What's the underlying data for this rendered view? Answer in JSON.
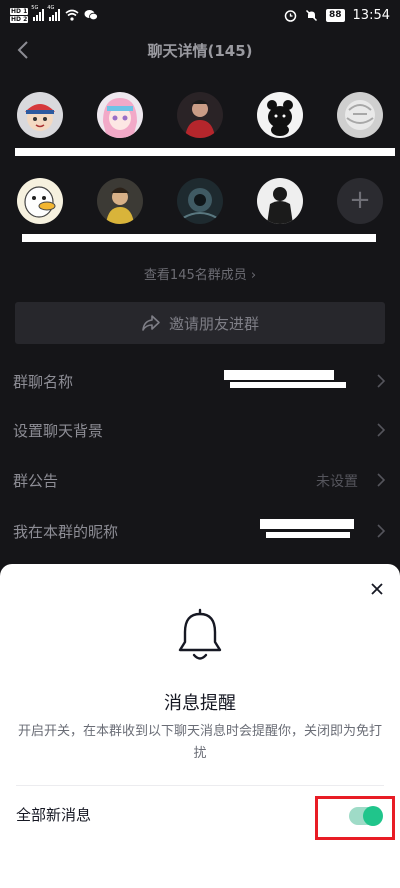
{
  "status_bar": {
    "sim1": "HD 1",
    "sim2": "HD 2",
    "net1": "5G",
    "net2": "4G",
    "battery": "88",
    "time": "13:54"
  },
  "header": {
    "title": "聊天详情(145)"
  },
  "members": {
    "count_link": "查看145名群成员 ›",
    "avatars": [
      {
        "icon": "boy-cap-avatar"
      },
      {
        "icon": "anime-girl-avatar"
      },
      {
        "icon": "photo-avatar"
      },
      {
        "icon": "bear-avatar"
      },
      {
        "icon": "pattern-avatar"
      },
      {
        "icon": "duck-avatar"
      },
      {
        "icon": "person-avatar"
      },
      {
        "icon": "dark-photo-avatar"
      },
      {
        "icon": "silhouette-avatar"
      }
    ],
    "add_icon": "plus-icon"
  },
  "invite": {
    "label": "邀请朋友进群",
    "icon": "share-icon"
  },
  "settings": {
    "group_name_label": "群聊名称",
    "background_label": "设置聊天背景",
    "announcement_label": "群公告",
    "announcement_value": "未设置",
    "nickname_label": "我在本群的昵称"
  },
  "sheet": {
    "title": "消息提醒",
    "description": "开启开关，在本群收到以下聊天消息时会提醒你，关闭即为免打扰",
    "option_label": "全部新消息",
    "toggle_on": true,
    "toggle_color": "#20c58b",
    "highlight_color": "#e81c25"
  }
}
